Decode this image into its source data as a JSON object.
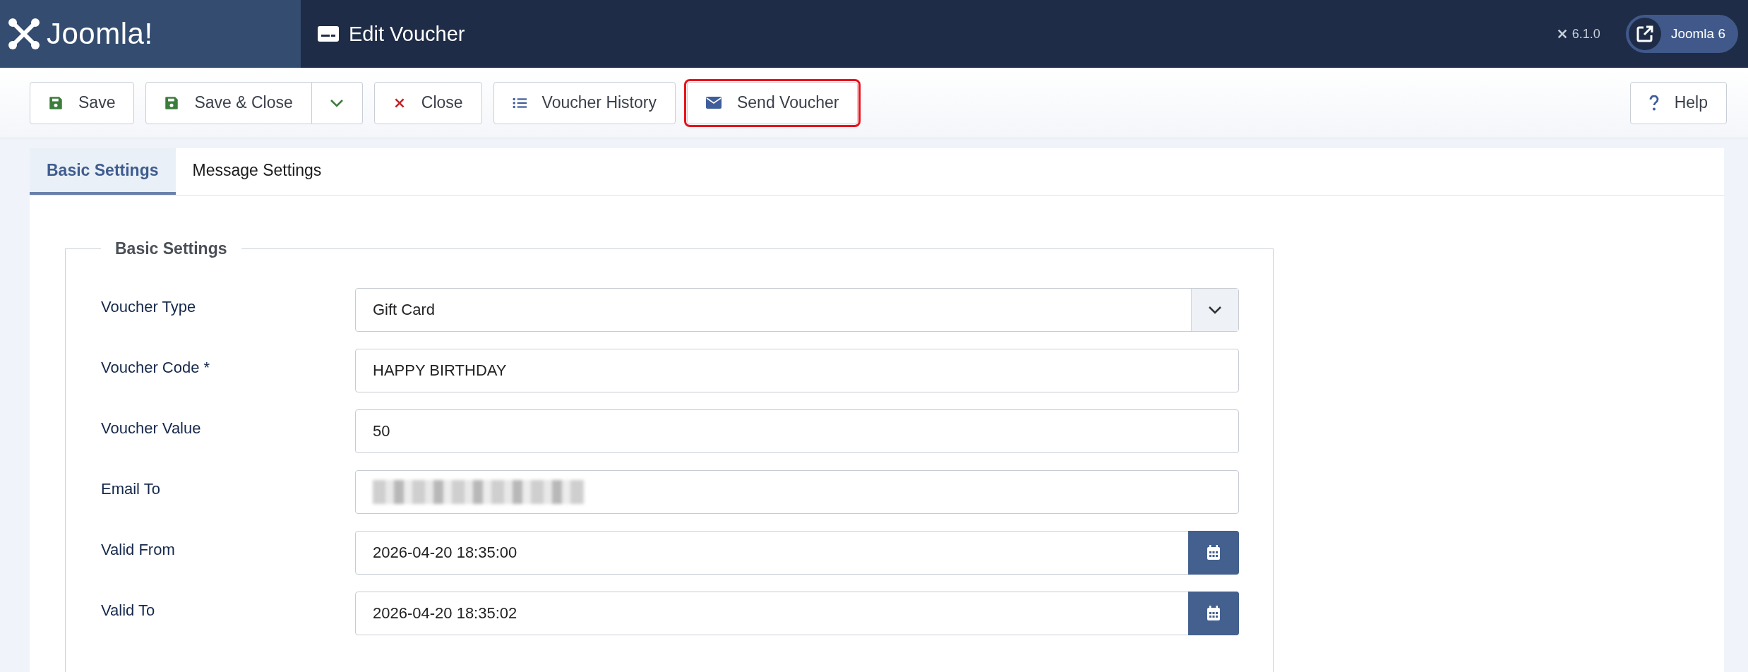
{
  "header": {
    "logo": "Joomla!",
    "title": "Edit Voucher",
    "version": "6.1.0",
    "site_link": "Joomla 6"
  },
  "toolbar": {
    "buttons": [
      {
        "label": "Save",
        "kind": "save",
        "highlighted": false,
        "dropdown": false
      },
      {
        "label": "Save & Close",
        "kind": "save",
        "highlighted": false,
        "dropdown": true
      },
      {
        "label": "Close",
        "kind": "close",
        "highlighted": false,
        "dropdown": false
      },
      {
        "label": "Voucher History",
        "kind": "history",
        "highlighted": false,
        "dropdown": false
      },
      {
        "label": "Send Voucher",
        "kind": "send",
        "highlighted": true,
        "dropdown": false
      }
    ],
    "help": "Help"
  },
  "tabs": [
    {
      "label": "Basic Settings",
      "selected": true
    },
    {
      "label": "Message Settings",
      "selected": false
    }
  ],
  "fieldset": {
    "legend": "Basic Settings",
    "fields": [
      {
        "label": "Voucher Type",
        "kind": "select",
        "value": "Gift Card"
      },
      {
        "label": "Voucher Code *",
        "kind": "text",
        "value": "HAPPY BIRTHDAY"
      },
      {
        "label": "Voucher Value",
        "kind": "text",
        "value": "50"
      },
      {
        "label": "Email To",
        "kind": "blurred"
      },
      {
        "label": "Valid From",
        "kind": "date",
        "value": "2026-04-20 18:35:00"
      },
      {
        "label": "Valid To",
        "kind": "date",
        "value": "2026-04-20 18:35:02"
      }
    ]
  }
}
